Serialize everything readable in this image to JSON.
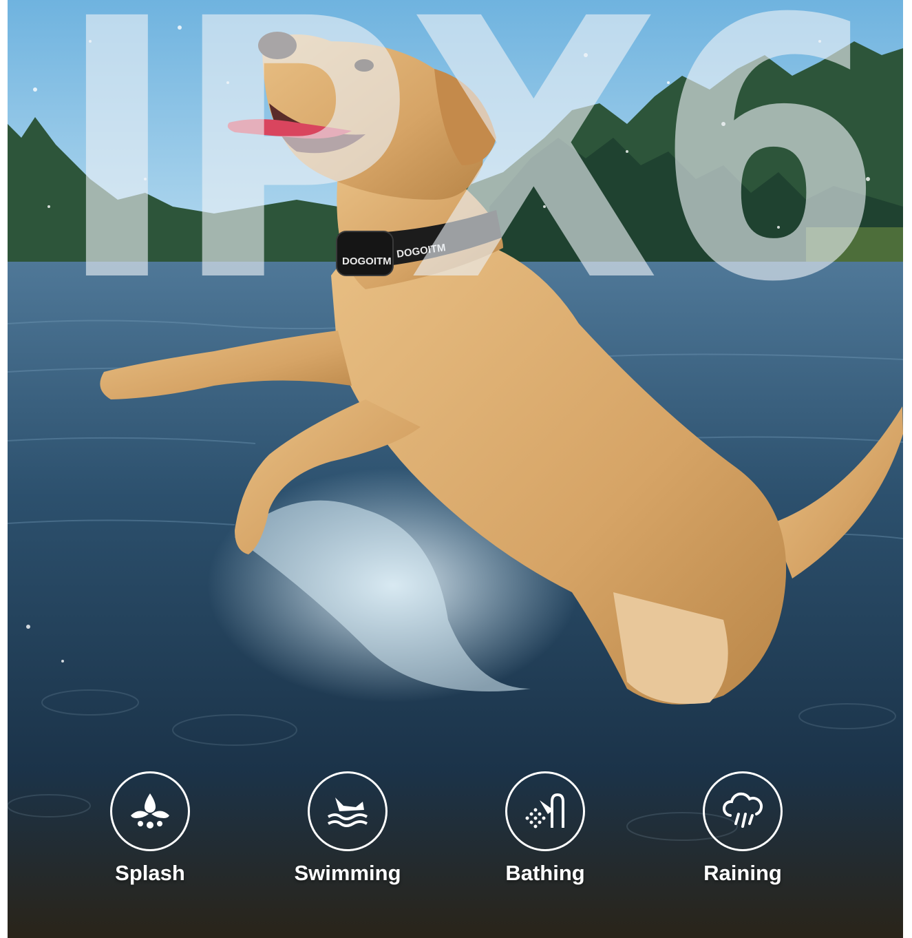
{
  "headline": "IPX6",
  "collar": {
    "brand_left": "DOGOITM",
    "brand_right": "DOGOITM"
  },
  "features": [
    {
      "label": "Splash",
      "icon": "splash-icon"
    },
    {
      "label": "Swimming",
      "icon": "swimming-dog-icon"
    },
    {
      "label": "Bathing",
      "icon": "shower-icon"
    },
    {
      "label": "Raining",
      "icon": "rain-cloud-icon"
    }
  ],
  "colors": {
    "sky": "#8fc3e4",
    "trees": "#2f5a3a",
    "water": "#24455f",
    "dog_fur": "#d9a86a",
    "collar": "#1c1c1c",
    "text": "#ffffff"
  }
}
